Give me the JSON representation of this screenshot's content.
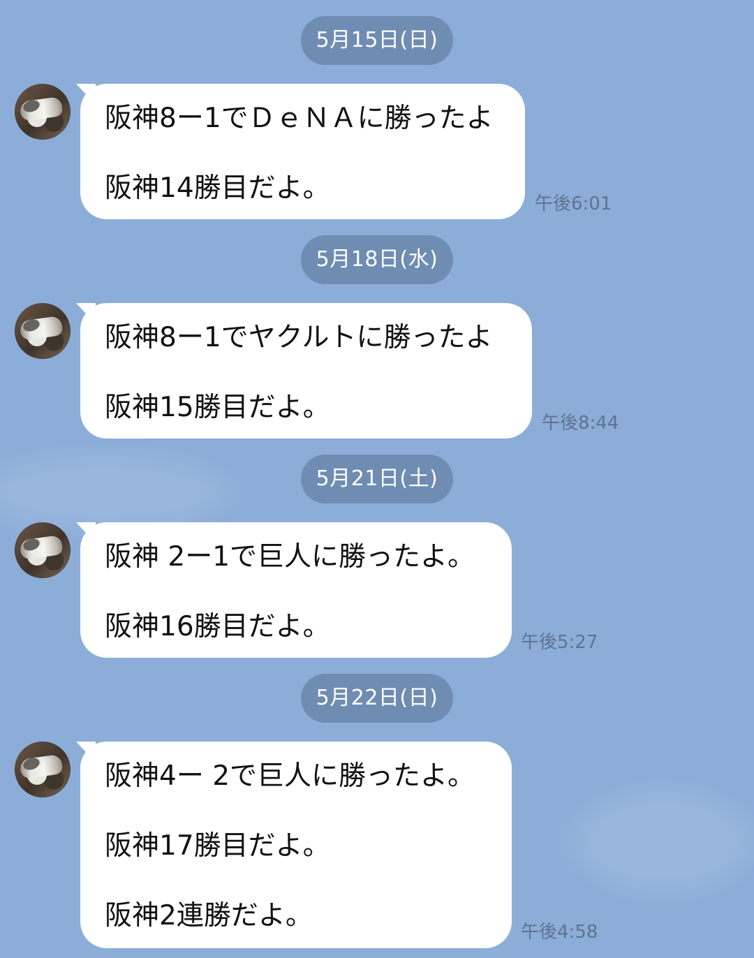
{
  "chat": {
    "groups": [
      {
        "date": "5月15日(日)",
        "lines": [
          "阪神8ー1でＤｅＮＡに勝ったよ",
          "阪神14勝目だよ。"
        ],
        "time": "午後6:01"
      },
      {
        "date": "5月18日(水)",
        "lines": [
          "阪神8ー1でヤクルトに勝ったよ",
          "阪神15勝目だよ。"
        ],
        "time": "午後8:44"
      },
      {
        "date": "5月21日(土)",
        "lines": [
          "阪神 2ー1で巨人に勝ったよ。",
          "阪神16勝目だよ。"
        ],
        "time": "午後5:27"
      },
      {
        "date": "5月22日(日)",
        "lines": [
          "阪神4ー 2で巨人に勝ったよ。",
          "阪神17勝目だよ。",
          "阪神2連勝だよ。"
        ],
        "time": "午後4:58"
      }
    ]
  }
}
